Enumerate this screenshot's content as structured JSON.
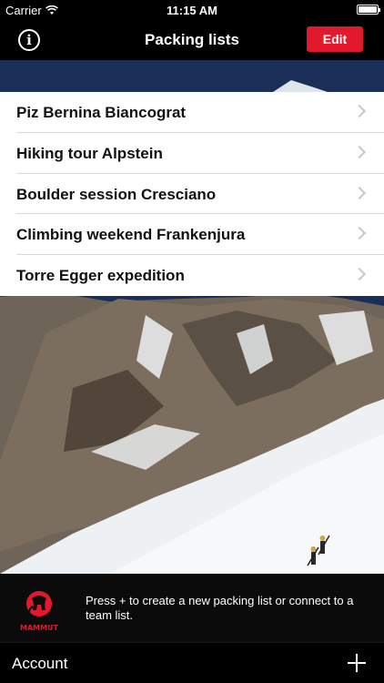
{
  "status_bar": {
    "carrier": "Carrier",
    "time": "11:15 AM",
    "battery_level": 1.0
  },
  "nav": {
    "title": "Packing lists",
    "edit_label": "Edit",
    "info_icon": "i"
  },
  "lists": [
    {
      "label": "Piz Bernina Biancograt"
    },
    {
      "label": "Hiking tour Alpstein"
    },
    {
      "label": "Boulder session Cresciano"
    },
    {
      "label": "Climbing weekend Frankenjura"
    },
    {
      "label": "Torre Egger expedition"
    }
  ],
  "footer": {
    "logo_text": "MAMMUT",
    "hint": "Press + to create a new packing list or connect to a team list."
  },
  "account": {
    "label": "Account"
  },
  "colors": {
    "accent": "#e2192c",
    "sky": "#1b2e57",
    "snow": "#eef1f4"
  }
}
